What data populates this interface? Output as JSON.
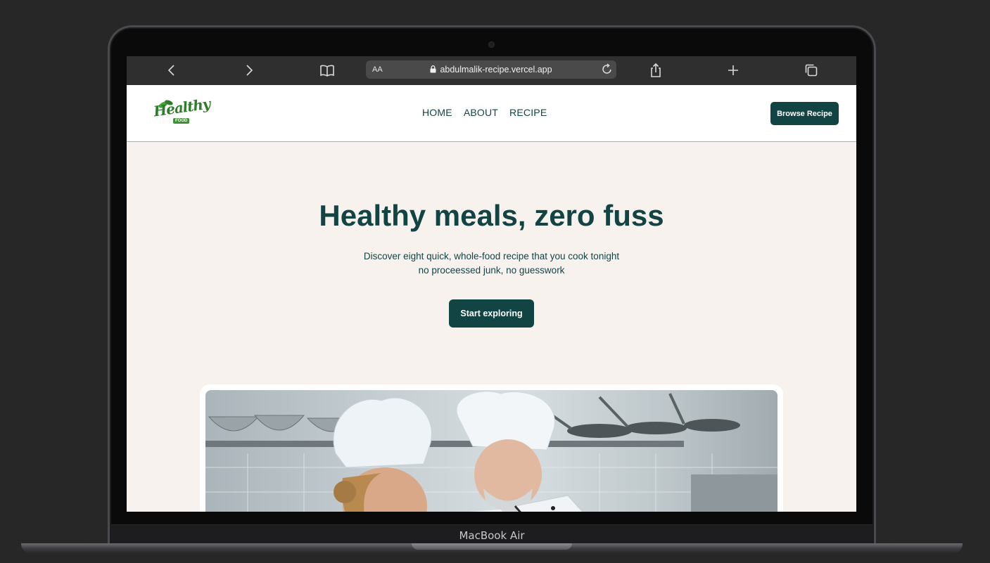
{
  "device": {
    "label": "MacBook Air"
  },
  "browser": {
    "text_size_label": "AA",
    "url": "abdulmalik-recipe.vercel.app"
  },
  "site": {
    "logo_text": "Healthy",
    "logo_subtext": "FOOD",
    "nav": [
      {
        "label": "HOME"
      },
      {
        "label": "ABOUT"
      },
      {
        "label": "RECIPE"
      }
    ],
    "browse_button_label": "Browse Recipe"
  },
  "hero": {
    "title": "Healthy meals, zero fuss",
    "subtitle_line1": "Discover eight quick, whole-food recipe that you cook tonight",
    "subtitle_line2": "no proceessed junk, no guesswork",
    "cta_label": "Start exploring"
  },
  "colors": {
    "brand_dark_teal": "#134444",
    "hero_background": "#f7f2ee",
    "logo_green": "#2f7d2a"
  },
  "icons": [
    "back-icon",
    "forward-icon",
    "bookmarks-icon",
    "lock-icon",
    "reload-icon",
    "share-icon",
    "new-tab-icon",
    "tabs-icon"
  ]
}
